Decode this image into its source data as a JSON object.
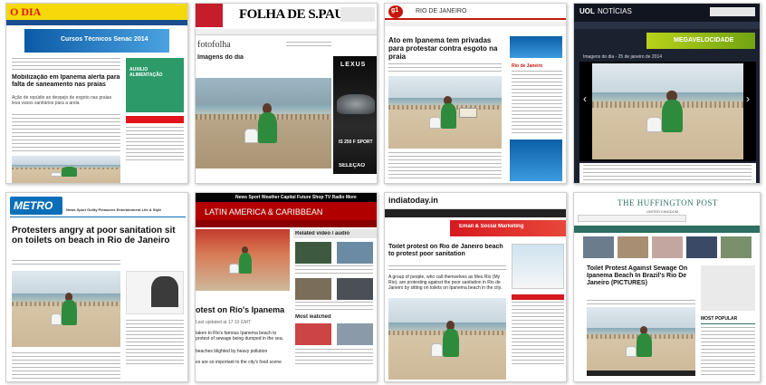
{
  "tiles": {
    "o_dia": {
      "logo": "O DIA",
      "banner": "Cursos Técnicos Senac 2014",
      "headline": "Mobilização em Ipanema alerta para falta de saneamento nas praias",
      "subhead": "Ação de repúdio ao despejo de esgoto nas praias leva vasos sanitários para a areia",
      "side_ad": "AUXÍLIO ALIMENTAÇÃO"
    },
    "folha": {
      "logo": "FOLHA DE S.PAULO",
      "section": "fotofolha",
      "gallery_title": "Imagens do dia",
      "ad_brand": "LEXUS",
      "ad_model": "IS 250 F SPORT",
      "ad_cta": "SELEÇÃO"
    },
    "g1": {
      "logo": "g1",
      "region": "RIO DE JANEIRO",
      "headline": "Ato em Ipanema tem privadas para protestar contra esgoto na praia",
      "side_label": "Rio de Janeiro"
    },
    "uol": {
      "logo": "UOL",
      "section": "NOTÍCIAS",
      "caption": "Imagens do dia - 25 de janeiro de 2014",
      "ad": "MEGAVELOCIDADE"
    },
    "metro": {
      "logo": "METRO",
      "nav": "News  Sport  Guilty Pleasures  Entertainment  Life & Style",
      "headline": "Protesters angry at poor sanitation sit on toilets on beach in Rio de Janeiro"
    },
    "bbc": {
      "section": "LATIN AMERICA & CARIBBEAN",
      "nav": "News  Sport  Weather  Capital  Future  Shop  TV  Radio  More",
      "headline": "otest on Rio's Ipanema",
      "last_updated": "Last updated at 17:10 GMT",
      "related": "Related video / audio",
      "most_watched": "Most watched",
      "body": "taken to Rio's famous Ipanema beach to protest of sewage being dumped in the sea.",
      "body2": "beaches blighted by heavy pollution",
      "body3": "es are so important to the city's food scene"
    },
    "indiatoday": {
      "logo": "indiatoday.in",
      "headline": "Toilet protest on Rio de Janeiro beach to protest poor sanitation",
      "body": "A group of people, who call themselves as Meu Rio (My Rio), are protesting against the poor sanitation in Rio de Janeiro by sitting on toilets on Ipanema beach in the city.",
      "ad": "Email & Social Marketing"
    },
    "huffpost": {
      "logo": "THE HUFFINGTON POST",
      "edition": "UNITED KINGDOM",
      "headline": "Toilet Protest Against Sewage On Ipanema Beach In Brazil's Rio De Janeiro (PICTURES)",
      "most_popular": "MOST POPULAR"
    }
  },
  "colors": {
    "odia_yellow": "#f5d90a",
    "odia_red": "#e4141b",
    "g1_red": "#c4170c",
    "uol_dark": "#1c2130",
    "metro_blue": "#0a6fb8",
    "bbc_red": "#b00000",
    "india_red": "#d71920",
    "huff_green": "#2e7061"
  }
}
